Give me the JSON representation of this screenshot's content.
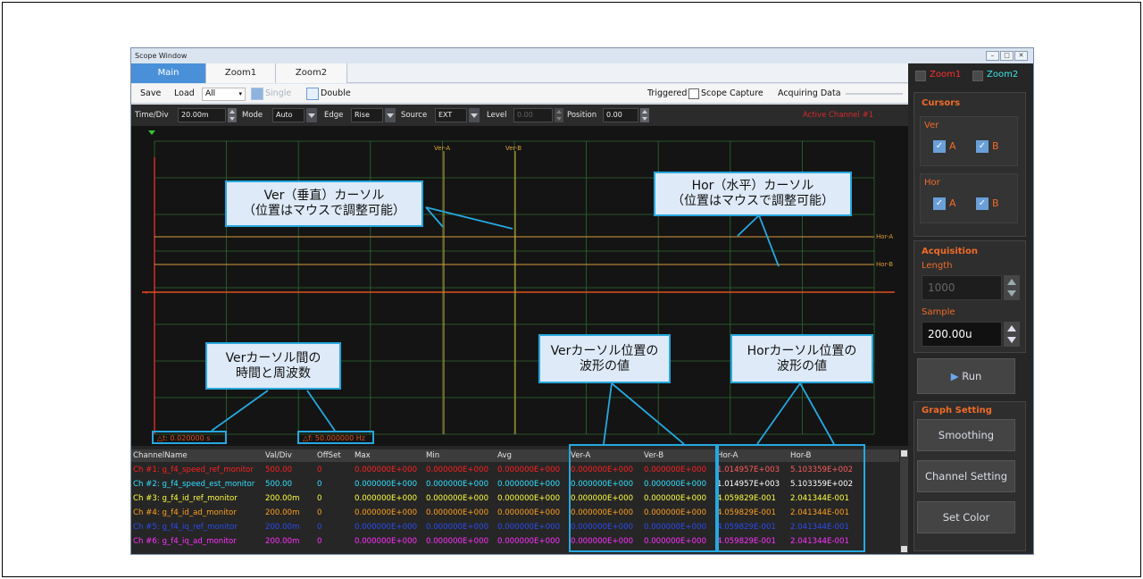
{
  "window": {
    "title": "Scope Window"
  },
  "tabs": [
    "Main",
    "Zoom1",
    "Zoom2"
  ],
  "toolbar": {
    "save": "Save",
    "load": "Load",
    "load_select": "All",
    "single": "Single",
    "double": "Double",
    "triggered": "Triggered",
    "scope_capture": "Scope Capture",
    "acquiring": "Acquiring Data"
  },
  "controls": {
    "time_div_label": "Time/Div",
    "time_div_value": "20.00m",
    "mode_label": "Mode",
    "mode_value": "Auto",
    "edge_label": "Edge",
    "edge_value": "Rise",
    "source_label": "Source",
    "source_value": "EXT",
    "level_label": "Level",
    "level_value": "0.00",
    "position_label": "Position",
    "position_value": "0.00",
    "active_channel": "Active Channel #1"
  },
  "plot": {
    "ver_a": "Ver-A",
    "ver_b": "Ver-B",
    "hor_a": "Hor-A",
    "hor_b": "Hor-B",
    "delta_t": "△t: 0.020000 s",
    "delta_f": "△f: 50.000000 Hz",
    "colors": {
      "grid": "#2e6b2e",
      "cursor_ver": "#d9a43a",
      "cursor_hor": "#d99a3a",
      "trace": "#e0501e",
      "marker": "#35c435"
    }
  },
  "table": {
    "headers": [
      "ChannelName",
      "Val/Div",
      "OffSet",
      "Max",
      "Min",
      "Avg",
      "Ver-A",
      "Ver-B",
      "Hor-A",
      "Hor-B"
    ],
    "rows": [
      {
        "color": "#ff2020",
        "hor_color": "#ff5a5a",
        "cells": [
          "Ch #1: g_f4_speed_ref_monitor",
          "500.00",
          "0",
          "0.000000E+000",
          "0.000000E+000",
          "0.000000E+000",
          "0.000000E+000",
          "0.000000E+000",
          "1.014957E+003",
          "5.103359E+002"
        ]
      },
      {
        "color": "#30e0ff",
        "hor_color": "#ffffff",
        "cells": [
          "Ch #2: g_f4_speed_est_monitor",
          "500.00",
          "0",
          "0.000000E+000",
          "0.000000E+000",
          "0.000000E+000",
          "0.000000E+000",
          "0.000000E+000",
          "1.014957E+003",
          "5.103359E+002"
        ]
      },
      {
        "color": "#ffff40",
        "hor_color": "#ffff40",
        "cells": [
          "Ch #3: g_f4_id_ref_monitor",
          "200.00m",
          "0",
          "0.000000E+000",
          "0.000000E+000",
          "0.000000E+000",
          "0.000000E+000",
          "0.000000E+000",
          "4.059829E-001",
          "2.041344E-001"
        ]
      },
      {
        "color": "#ffa020",
        "hor_color": "#ffa020",
        "cells": [
          "Ch #4: g_f4_id_ad_monitor",
          "200.00m",
          "0",
          "0.000000E+000",
          "0.000000E+000",
          "0.000000E+000",
          "0.000000E+000",
          "0.000000E+000",
          "4.059829E-001",
          "2.041344E-001"
        ]
      },
      {
        "color": "#2a4cf0",
        "hor_color": "#2a4cf0",
        "cells": [
          "Ch #5: g_f4_iq_ref_monitor",
          "200.00m",
          "0",
          "0.000000E+000",
          "0.000000E+000",
          "0.000000E+000",
          "0.000000E+000",
          "0.000000E+000",
          "4.059829E-001",
          "2.041344E-001"
        ]
      },
      {
        "color": "#ff30ff",
        "hor_color": "#ff30ff",
        "cells": [
          "Ch #6: g_f4_iq_ad_monitor",
          "200.00m",
          "0",
          "0.000000E+000",
          "0.000000E+000",
          "0.000000E+000",
          "0.000000E+000",
          "0.000000E+000",
          "4.059829E-001",
          "2.041344E-001"
        ]
      }
    ]
  },
  "panel": {
    "zoom1": "Zoom1",
    "zoom2": "Zoom2",
    "cursors": "Cursors",
    "ver": "Ver",
    "hor": "Hor",
    "a": "A",
    "b": "B",
    "acquisition": "Acquisition",
    "length": "Length",
    "length_value": "1000",
    "sample": "Sample",
    "sample_value": "200.00u",
    "run": "Run",
    "graph_setting": "Graph Setting",
    "smoothing": "Smoothing",
    "channel_setting": "Channel Setting",
    "set_color": "Set Color",
    "colors": {
      "accent": "#f06b28",
      "zoom1": "#ff3030",
      "zoom2": "#3de8e8",
      "button": "#444444"
    }
  },
  "annotations": {
    "ver_cursor_line1": "Ver（垂直）カーソル",
    "ver_cursor_line2": "（位置はマウスで調整可能）",
    "hor_cursor_line1": "Hor（水平）カーソル",
    "hor_cursor_line2": "（位置はマウスで調整可能）",
    "time_freq_line1": "Verカーソル間の",
    "time_freq_line2": "時間と周波数",
    "ver_values_line1": "Verカーソル位置の",
    "ver_values_line2": "波形の値",
    "hor_values_line1": "Horカーソル位置の",
    "hor_values_line2": "波形の値",
    "color": "#27a8df"
  }
}
